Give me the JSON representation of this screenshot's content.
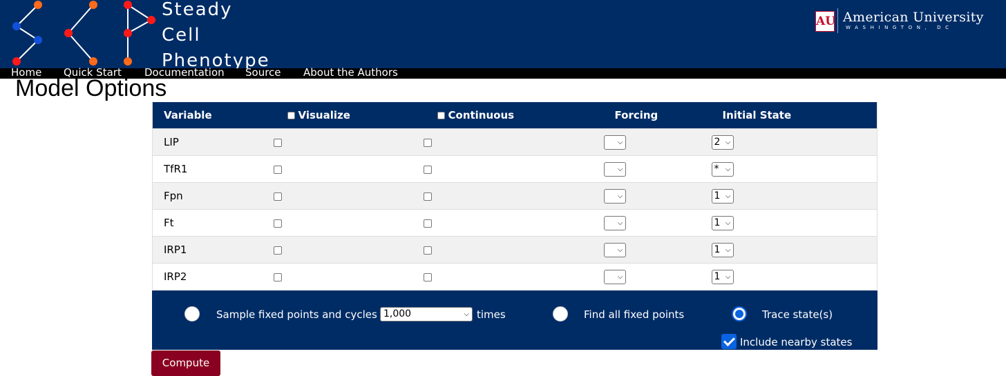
{
  "header": {
    "brand_lines": [
      "Steady",
      "Cell",
      "Phenotype"
    ],
    "logo_icon": "network-graph-logo",
    "university_name": "American University",
    "university_location": "WASHINGTON, DC",
    "university_mark": "AU"
  },
  "nav": {
    "items": [
      "Home",
      "Quick Start",
      "Documentation",
      "Source",
      "About the Authors"
    ]
  },
  "page_title": "Model Options",
  "table": {
    "headers": {
      "variable": "Variable",
      "visualize": "Visualize",
      "continuous": "Continuous",
      "forcing": "Forcing",
      "initial_state": "Initial State"
    },
    "rows": [
      {
        "variable": "LIP",
        "forcing": "",
        "initial_state": "2"
      },
      {
        "variable": "TfR1",
        "forcing": "",
        "initial_state": "*"
      },
      {
        "variable": "Fpn",
        "forcing": "",
        "initial_state": "1"
      },
      {
        "variable": "Ft",
        "forcing": "",
        "initial_state": "1"
      },
      {
        "variable": "IRP1",
        "forcing": "",
        "initial_state": "1"
      },
      {
        "variable": "IRP2",
        "forcing": "",
        "initial_state": "1"
      }
    ]
  },
  "options": {
    "sample_label": "Sample fixed points and cycles",
    "sample_count": "1,000",
    "times_label": "times",
    "find_all_label": "Find all fixed points",
    "trace_label": "Trace state(s)",
    "selected": "trace",
    "nearby_label": "Include nearby states",
    "nearby_checked": true
  },
  "compute_label": "Compute",
  "colors": {
    "navy": "#002c66",
    "compute": "#8a0020",
    "accent": "#0a63e0",
    "node_red": "#ff1a1a",
    "node_blue": "#1150d8",
    "node_orange": "#ff6b1a"
  }
}
